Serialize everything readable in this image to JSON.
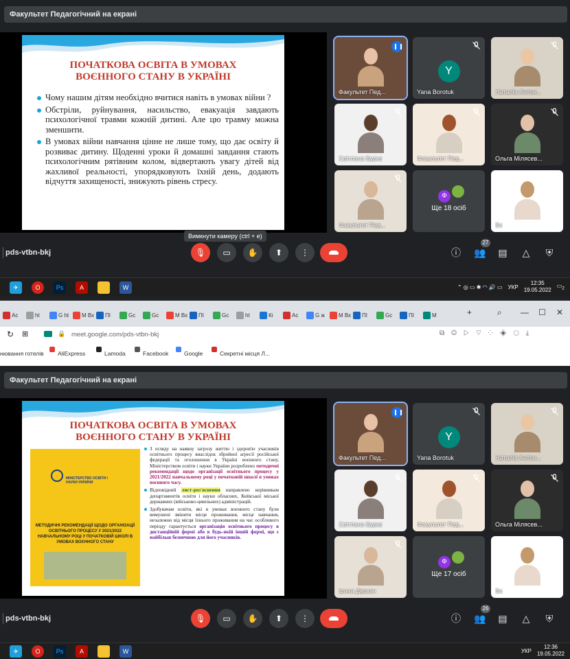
{
  "meet_top": {
    "presenting_label": "Факультет Педагогічний на екрані",
    "slide": {
      "title_lines": [
        "ПОЧАТКОВА ОСВІТА В УМОВАХ",
        "ВОЄННОГО СТАНУ В УКРАЇНІ"
      ],
      "bullets": [
        "Чому нашим дітям необхідно вчитися навіть в умовах війни ?",
        "Обстріли, руйнування, насильство, евакуація завдають психологічної травми кожній дитині. Але цю травму можна зменшити.",
        "В умовах війни навчання цінне не лише тому, що дає освіту й розвиває дитину. Щоденні уроки й домашні завдання стають психологічним рятівним колом, відвертають увагу дітей від жахливої реальності, упорядковують їхній день, додають відчуття захищеності, знижують рівень стресу."
      ]
    },
    "tiles": [
      {
        "name": "Факультет Пед...",
        "kind": "video",
        "active": true
      },
      {
        "name": "Yana Borotuk",
        "kind": "avatar",
        "initial": "Y"
      },
      {
        "name": "Наталія Антон...",
        "kind": "video"
      },
      {
        "name": "Світлана Бурка",
        "kind": "video"
      },
      {
        "name": "Факультет Пед...",
        "kind": "video"
      },
      {
        "name": "Ольга Мілясев...",
        "kind": "video"
      },
      {
        "name": "Факультет Пед...",
        "kind": "video"
      },
      {
        "name": "Ще 18 осіб",
        "kind": "more"
      },
      {
        "name": "Ви",
        "kind": "video"
      }
    ],
    "more_initial": "Ф",
    "tooltip": "Вимкнути камеру (ctrl + e)",
    "meeting_code": "pds-vtbn-bkj",
    "participants_count": "27"
  },
  "taskbar_top": {
    "lang": "УКР",
    "time": "12:35",
    "date": "19.05.2022",
    "notif": "2"
  },
  "browser": {
    "url": "meet.google.com/pds-vtbn-bkj",
    "tabs": [
      "Ac",
      "ht",
      "G ht",
      "M Вх",
      "ПІ",
      "Gc",
      "Gc",
      "M Вх",
      "ПІ",
      "Gc",
      "ht",
      "Кі",
      "Ac",
      "G ж",
      "M Вх",
      "ПІ",
      "Gc",
      "ПІ",
      "M"
    ],
    "new_tab": "+",
    "bookmarks": [
      "нювання готелів",
      "AliExpress",
      "Lamoda",
      "Facebook",
      "Google",
      "Секретні місця Л..."
    ]
  },
  "meet_bottom": {
    "presenting_label": "Факультет Педагогічний на екрані",
    "slide": {
      "title_lines": [
        "ПОЧАТКОВА ОСВІТА В УМОВАХ",
        "ВОЄННОГО СТАНУ В УКРАЇНІ"
      ],
      "image_caption": "МЕТОДИЧНІ РЕКОМЕНДАЦІЇ ЩОДО ОРГАНІЗАЦІЇ ОСВІТНЬОГО ПРОЦЕСУ У 2021/2022 НАВЧАЛЬНОМУ РОЦІ У ПОЧАТКОВІЙ ШКОЛІ В УМОВАХ ВОЄННОГО СТАНУ",
      "image_logo": "МІНІСТЕРСТВО ОСВІТИ І НАУКИ УКРАЇНИ",
      "p1_a": "З огляду на наявну загрозу життю і здоров'ю учасників освітнього процесу внаслідок збройної агресії російської федерації та оголошення в Україні воєнного стану, Міністерством освіти і науки України розроблено ",
      "p1_hl": "методичні рекомендації щодо організації освітнього процесу у 2021/2022 навчальному році у початковій школі в умовах воєнного часу.",
      "p2_a": "Відповідний ",
      "p2_hl": "лист-роз'яснення",
      "p2_b": " направлено керівникам департаментів освіти і науки обласних, Київської міської державних (військово-цивільних) адміністрацій.",
      "p3_a": "Здобувачам освіти, які в умовах воєнного стану були вимушені змінити місце проживання, місце навчання, незалежно від місця їхнього проживання на час особливого періоду гарантується ",
      "p3_hl": "організація освітнього процесу в дистанційній формі або в будь-якій іншій формі, що є найбільш безпечною для його учасників."
    },
    "tiles": [
      {
        "name": "Факультет Пед...",
        "kind": "video",
        "active": true
      },
      {
        "name": "Yana Borotuk",
        "kind": "avatar",
        "initial": "Y"
      },
      {
        "name": "Наталія Антон...",
        "kind": "video"
      },
      {
        "name": "Світлана Бурка",
        "kind": "video"
      },
      {
        "name": "Факультет Пед...",
        "kind": "video"
      },
      {
        "name": "Ольга Мілясев...",
        "kind": "video"
      },
      {
        "name": "Ірина Деркач",
        "kind": "video"
      },
      {
        "name": "Ще 17 осіб",
        "kind": "more"
      },
      {
        "name": "Ви",
        "kind": "video"
      }
    ],
    "more_initial": "Ф",
    "meeting_code": "pds-vtbn-bkj",
    "participants_count": "26"
  },
  "taskbar_bottom": {
    "lang": "УКР",
    "time": "12:36",
    "date": "19.05.2022"
  },
  "colors": {
    "meet_bg": "#202124",
    "hangup": "#ea4335",
    "accent": "#1a73e8",
    "slide_title": "#c0392b"
  }
}
